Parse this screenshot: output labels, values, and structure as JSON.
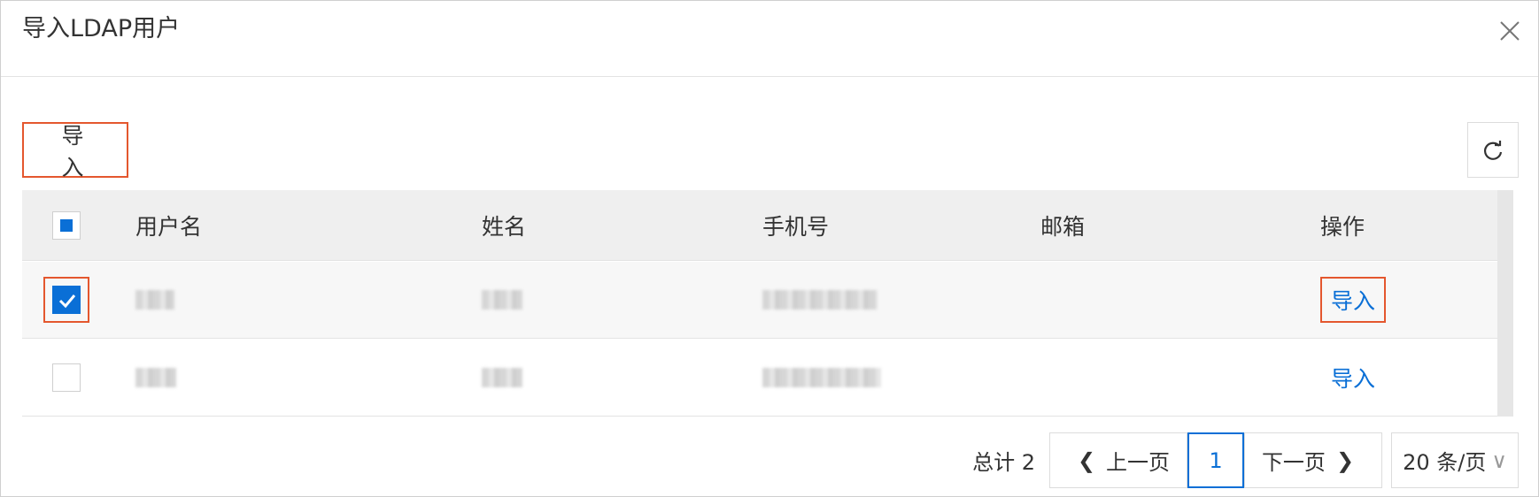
{
  "dialog": {
    "title": "导入LDAP用户",
    "close_icon": "close-icon"
  },
  "toolbar": {
    "import_label": "导 入",
    "refresh_icon": "refresh-icon"
  },
  "table": {
    "headers": [
      "用户名",
      "姓名",
      "手机号",
      "邮箱",
      "操作"
    ],
    "rows": [
      {
        "checked": true,
        "username": "",
        "name": "",
        "phone": "",
        "email": "",
        "action": "导入"
      },
      {
        "checked": false,
        "username": "",
        "name": "",
        "phone": "",
        "email": "",
        "action": "导入"
      }
    ]
  },
  "pagination": {
    "total": "总计 2",
    "prev": "上一页",
    "current": "1",
    "next": "下一页",
    "page_size": "20 条/页"
  },
  "colors": {
    "accent": "#0a6fd6",
    "highlight": "#e4572e",
    "header_bg": "#efefef"
  }
}
